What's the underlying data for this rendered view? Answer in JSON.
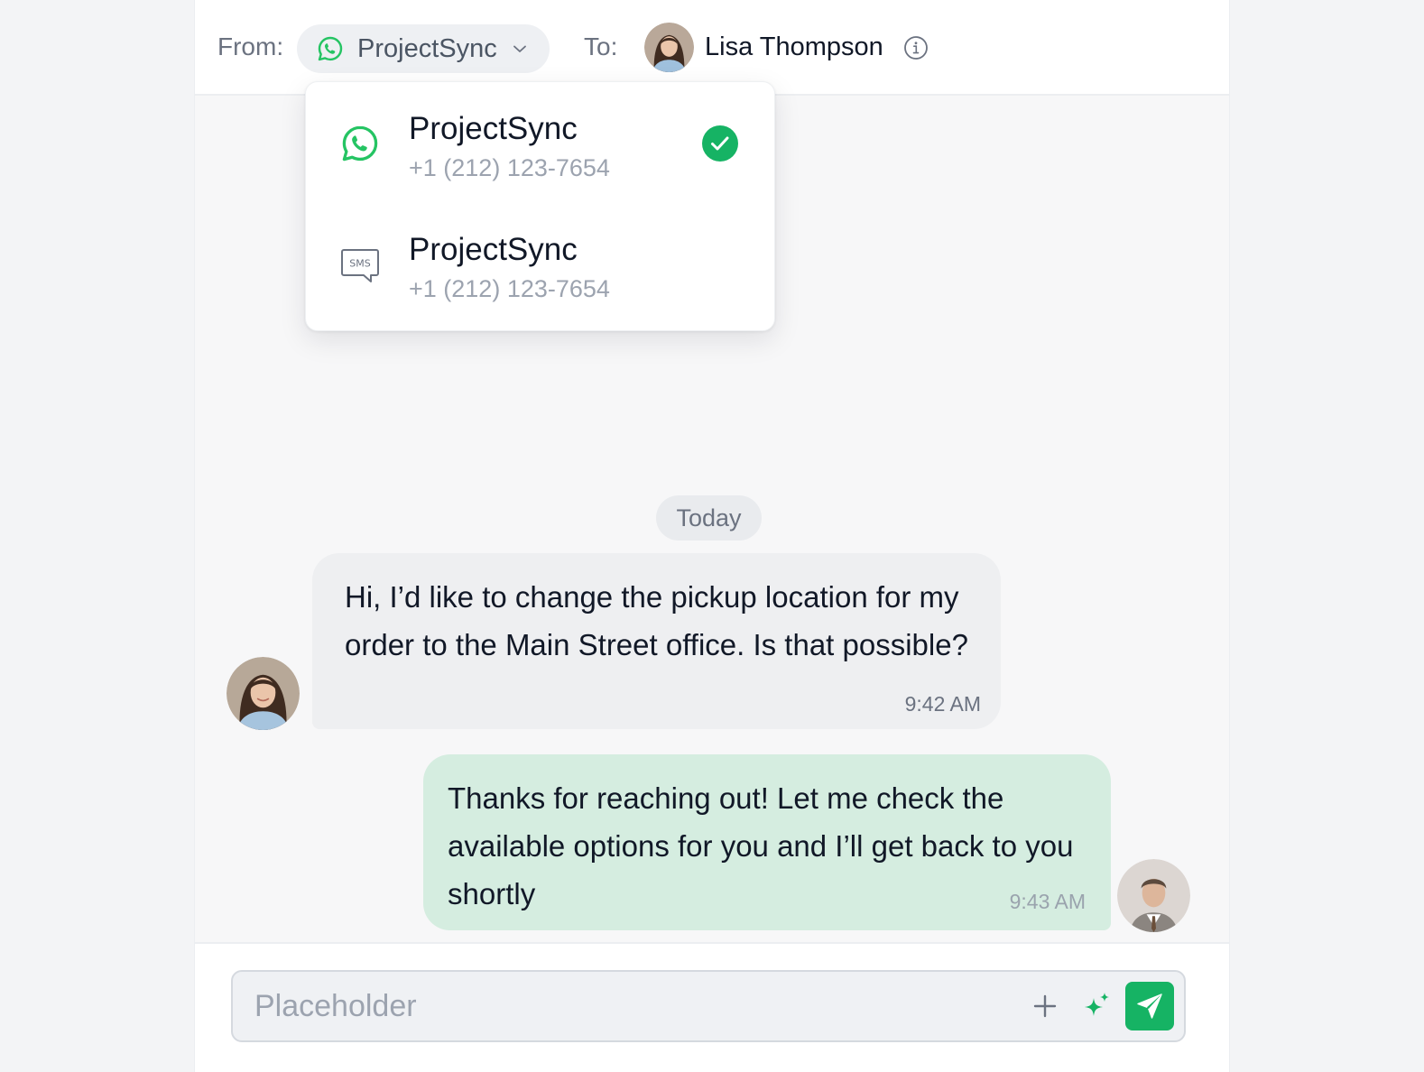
{
  "header": {
    "from_label": "From:",
    "to_label": "To:",
    "selected_channel": "ProjectSync",
    "selected_channel_icon": "whatsapp-icon",
    "contact_name": "Lisa Thompson"
  },
  "dropdown": {
    "options": [
      {
        "icon": "whatsapp-icon",
        "title": "ProjectSync",
        "number": "+1 (212) 123-7654",
        "selected": true
      },
      {
        "icon": "sms-icon",
        "title": "ProjectSync",
        "number": "+1 (212) 123-7654",
        "selected": false
      }
    ]
  },
  "conversation": {
    "date_divider": "Today",
    "messages": [
      {
        "direction": "incoming",
        "text": "Hi, I’d like to change the pickup location for my order to the Main Street office. Is that possible?",
        "time": "9:42 AM"
      },
      {
        "direction": "outgoing",
        "text": "Thanks for reaching out! Let me check the available options for you and I’ll get back to you shortly",
        "time": "9:43 AM"
      }
    ]
  },
  "composer": {
    "placeholder": "Placeholder",
    "value": ""
  },
  "colors": {
    "accent": "#16b364",
    "whatsapp": "#25c463",
    "incoming_bubble": "#eeeff1",
    "outgoing_bubble": "#d5ede0"
  }
}
